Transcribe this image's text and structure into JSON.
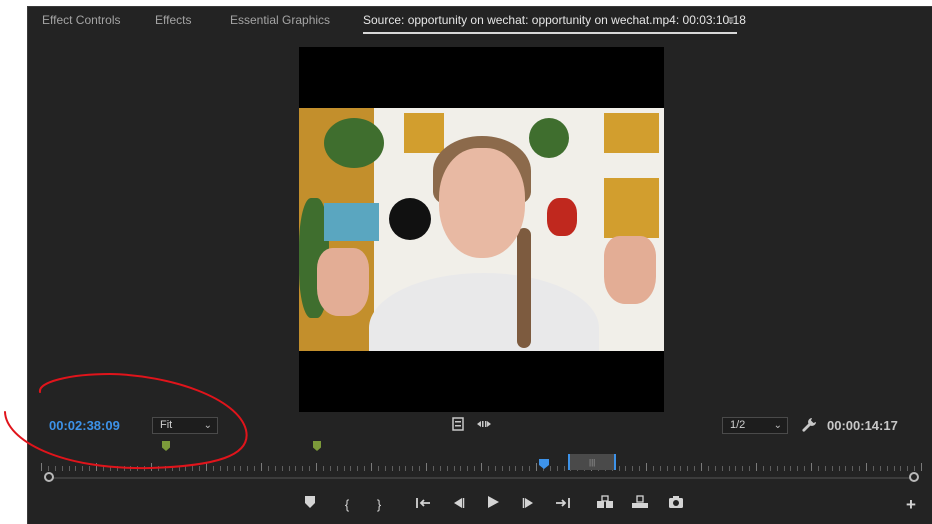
{
  "tabs": [
    {
      "label": "Effect Controls"
    },
    {
      "label": "Effects"
    },
    {
      "label": "Essential Graphics"
    },
    {
      "label": "Source: opportunity on wechat: opportunity on wechat.mp4: 00:03:10:18"
    }
  ],
  "tab_menu_icon": "hamburger-menu-icon",
  "playhead_timecode": "00:02:38:09",
  "zoom_select": {
    "value": "Fit"
  },
  "resolution_select": {
    "value": "1/2"
  },
  "duration_timecode": "00:00:14:17",
  "accent_color": "#3d92e8",
  "marker_color": "#7c9a3a",
  "annotation_color": "#e0141b",
  "transport_icons": [
    "add-marker-icon",
    "mark-in-icon",
    "mark-out-icon",
    "go-to-in-icon",
    "step-back-icon",
    "play-icon",
    "step-forward-icon",
    "go-to-out-icon",
    "insert-icon",
    "overwrite-icon",
    "export-frame-icon"
  ]
}
